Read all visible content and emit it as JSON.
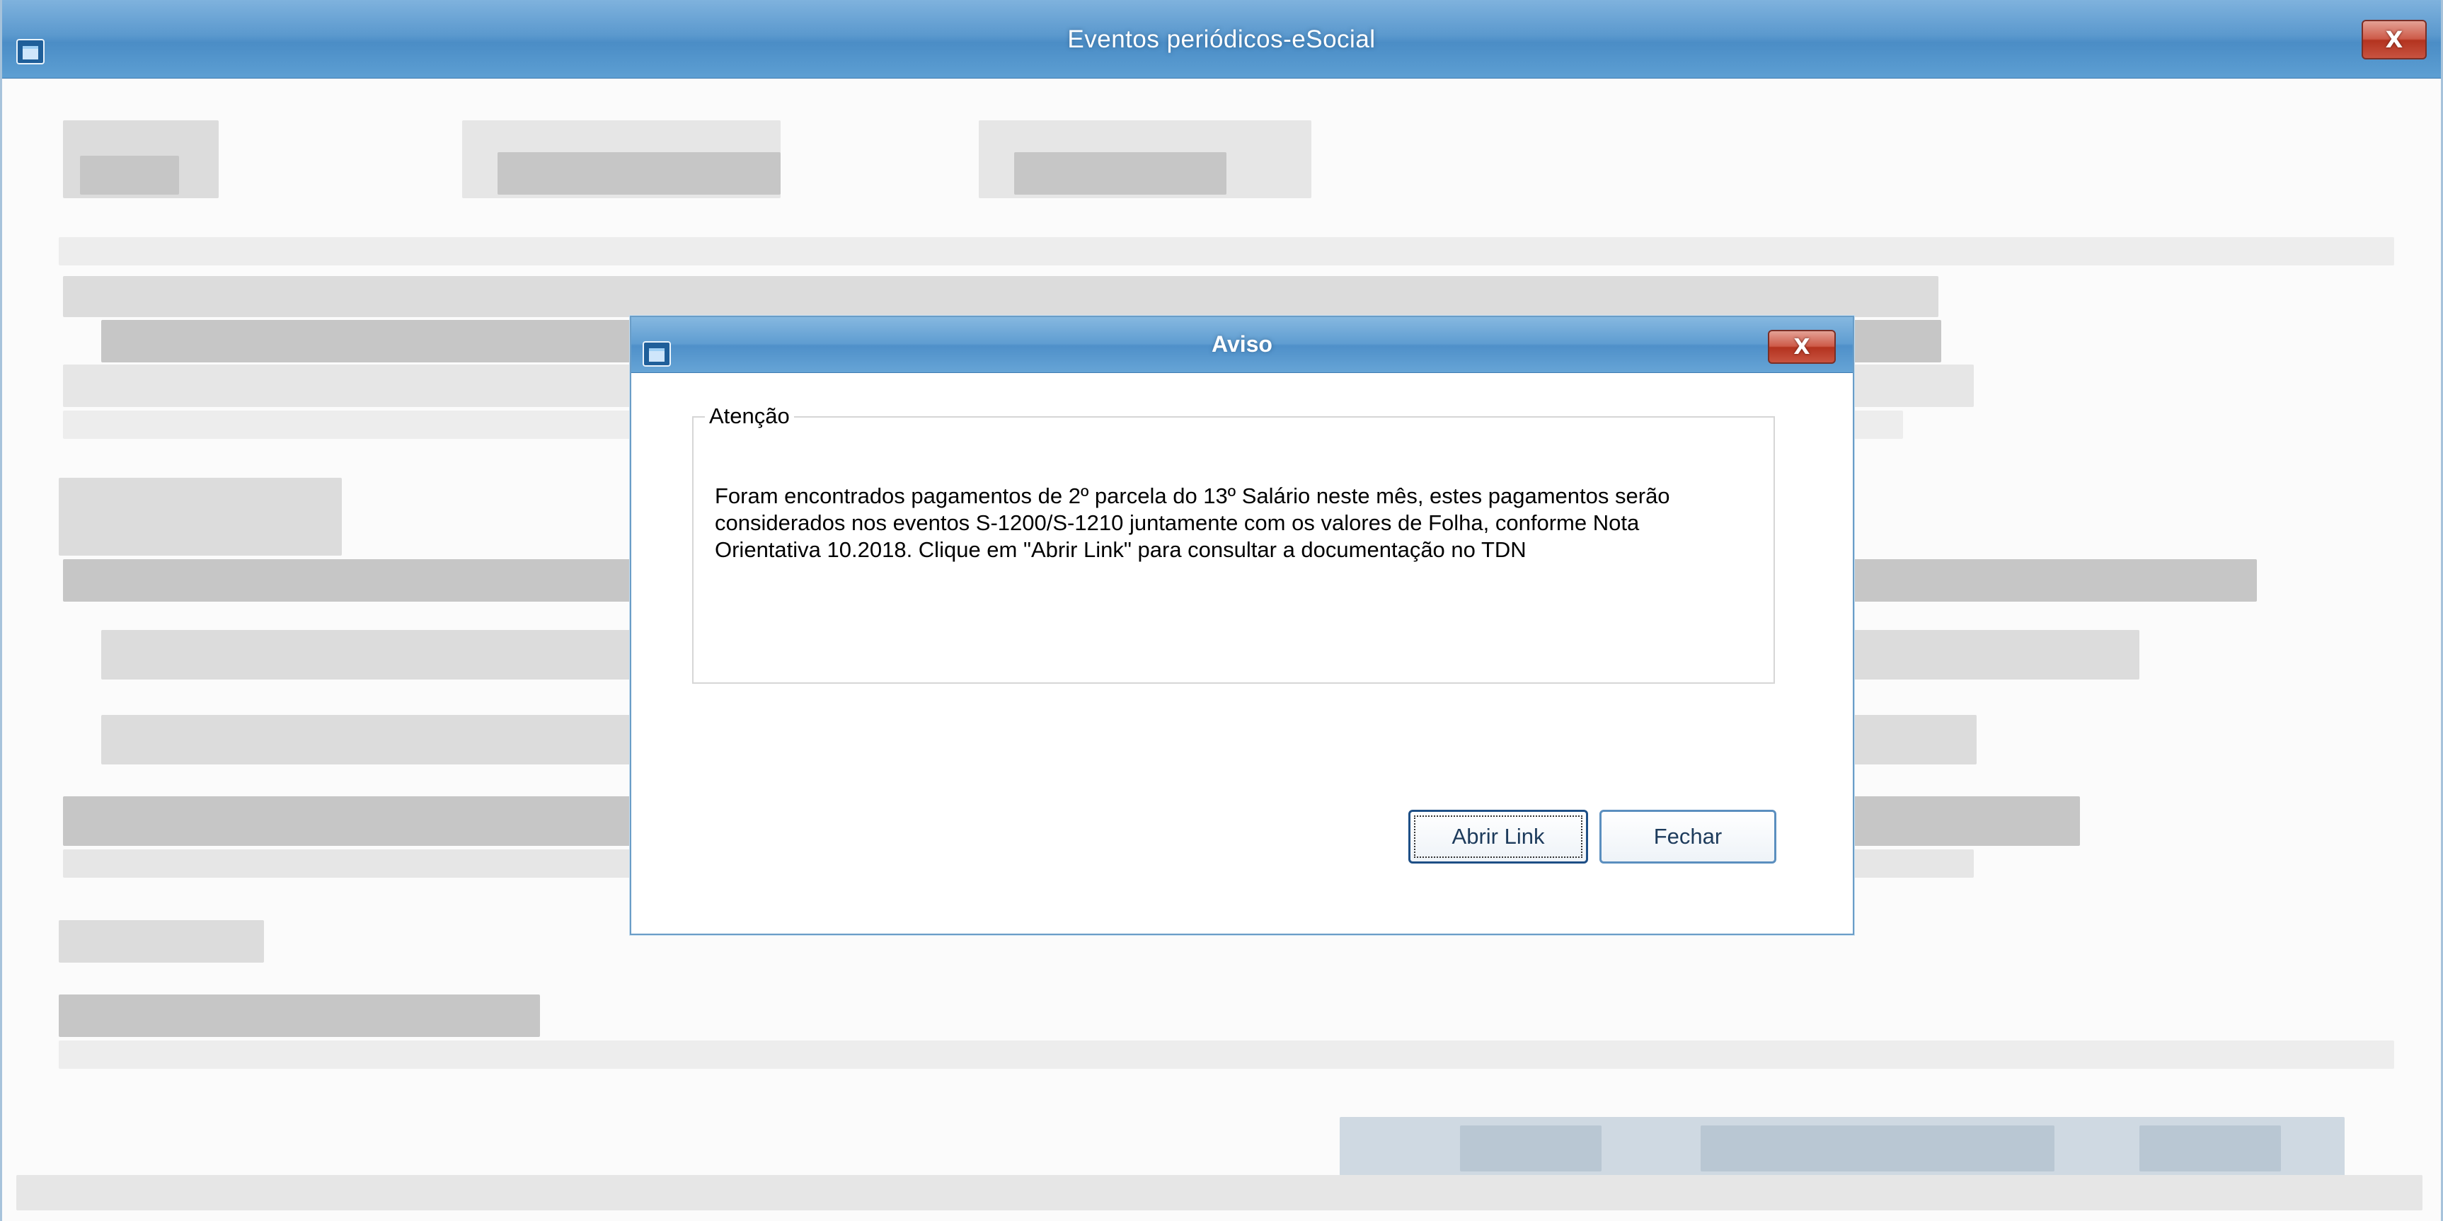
{
  "main_window": {
    "title": "Eventos periódicos-eSocial",
    "icon": "window-icon",
    "close_label": "X"
  },
  "dialog": {
    "title": "Aviso",
    "icon": "window-icon",
    "close_label": "X",
    "group_label": "Atenção",
    "message": "Foram encontrados pagamentos de 2º parcela do 13º Salário neste mês, estes pagamentos serão considerados nos eventos S-1200/S-1210 juntamente com os valores de Folha, conforme Nota Orientativa 10.2018. Clique em \"Abrir Link\" para consultar a documentação no TDN",
    "buttons": {
      "open_link": "Abrir Link",
      "close": "Fechar"
    }
  },
  "colors": {
    "titlebar": "#5b99ce",
    "close_button": "#c85340",
    "button_border": "#1e4f86"
  }
}
